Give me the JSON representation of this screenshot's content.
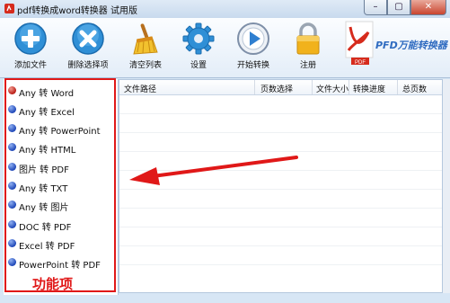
{
  "window": {
    "title": "pdf转换成word转换器 试用版"
  },
  "toolbar": {
    "add_file": "添加文件",
    "remove_selected": "删除选择项",
    "clear_list": "清空列表",
    "settings": "设置",
    "start_convert": "开始转换",
    "register": "注册",
    "brand": "PFD万能转换器"
  },
  "functions": [
    {
      "label": "Any 转 Word",
      "active": true
    },
    {
      "label": "Any 转 Excel"
    },
    {
      "label": "Any 转 PowerPoint"
    },
    {
      "label": "Any 转 HTML"
    },
    {
      "label": "图片 转 PDF"
    },
    {
      "label": "Any 转 TXT"
    },
    {
      "label": "Any 转 图片"
    },
    {
      "label": "DOC 转 PDF"
    },
    {
      "label": "Excel 转 PDF"
    },
    {
      "label": "PowerPoint 转 PDF"
    }
  ],
  "annotation": {
    "caption": "功能项",
    "color": "#e01818"
  },
  "table": {
    "columns": [
      "文件路径",
      "页数选择",
      "文件大小",
      "转换进度",
      "总页数"
    ]
  },
  "icons": {
    "add": "plus-circle-icon",
    "remove": "x-circle-icon",
    "clear": "broom-icon",
    "settings": "gear-icon",
    "start": "play-circle-icon",
    "register": "lock-icon",
    "brand": "pdf-logo-icon"
  }
}
